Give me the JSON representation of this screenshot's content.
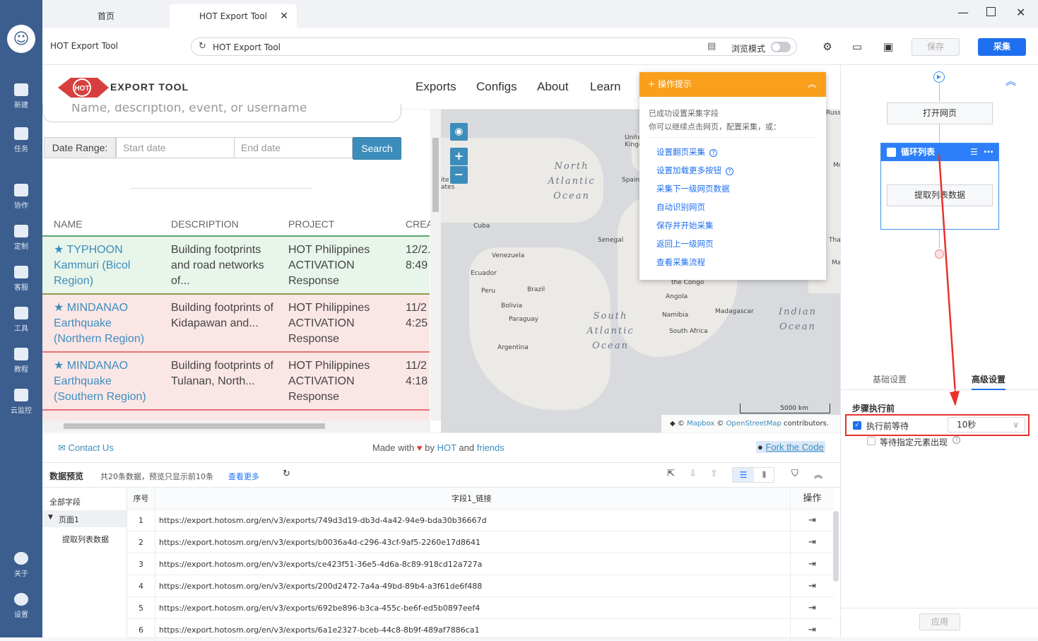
{
  "nav": {
    "items": [
      {
        "label": "新建",
        "icon": "new-icon"
      },
      {
        "label": "任务",
        "icon": "task-icon"
      },
      {
        "label": "协作",
        "icon": "collab-icon"
      },
      {
        "label": "定制",
        "icon": "custom-icon"
      },
      {
        "label": "客服",
        "icon": "headset-icon"
      },
      {
        "label": "工具",
        "icon": "toolbox-icon"
      },
      {
        "label": "教程",
        "icon": "tutorial-icon"
      },
      {
        "label": "云监控",
        "icon": "cloud-icon"
      },
      {
        "label": "关于",
        "icon": "info-icon"
      },
      {
        "label": "设置",
        "icon": "gear-icon"
      }
    ]
  },
  "tabs": {
    "home": "首页",
    "active": "HOT Export Tool"
  },
  "toolbar": {
    "page_title": "HOT Export Tool",
    "url": "HOT Export Tool",
    "browse_mode": "浏览模式",
    "save": "保存",
    "collect": "采集"
  },
  "web": {
    "brand": "EXPORT TOOL",
    "logo_text": "HOT",
    "nav": [
      "Exports",
      "Configs",
      "About",
      "Learn"
    ],
    "search_placeholder": "Name, description, event, or username",
    "date_range_label": "Date Range:",
    "start_placeholder": "Start date",
    "end_placeholder": "End date",
    "search_button": "Search",
    "table": {
      "headers": [
        "NAME",
        "DESCRIPTION",
        "PROJECT",
        "CREA"
      ],
      "rows": [
        {
          "name": "★ TYPHOON Kammuri (Bicol Region)",
          "desc": "Building footprints and road networks of...",
          "project": "HOT Philippines ACTIVATION Response",
          "date": "12/2. 8:49"
        },
        {
          "name": "★ MINDANAO Earthquake (Northern Region)",
          "desc": "Building footprints of Kidapawan and...",
          "project": "HOT Philippines ACTIVATION Response",
          "date": "11/2 4:25"
        },
        {
          "name": "★ MINDANAO Earthquake (Southern Region)",
          "desc": "Building footprints of Tulanan, North...",
          "project": "HOT Philippines ACTIVATION Response",
          "date": "11/2 4:18"
        }
      ]
    },
    "map": {
      "labels": [
        "Cuba",
        "Venezuela",
        "Ecuador",
        "Peru",
        "Brazil",
        "Bolivia",
        "Paraguay",
        "Argentina",
        "Senegal",
        "Spain",
        "the Congo",
        "Angola",
        "Namibia",
        "South Africa",
        "Madagascar",
        "United Kingd",
        "ite ates",
        "Russ",
        "Tha",
        "Ma",
        "Mc"
      ],
      "oceans": [
        "North Atlantic Ocean",
        "South Atlantic Ocean",
        "Indian Ocean"
      ],
      "scale": "5000 km",
      "attribution": {
        "mapbox": "Mapbox",
        "osm": "OpenStreetMap",
        "suffix": "contributors."
      }
    },
    "footer": {
      "contact": "Contact Us",
      "made_with": "Made with",
      "by": "by",
      "hot": "HOT",
      "and": "and",
      "friends": "friends",
      "fork": "Fork the Code"
    }
  },
  "tips": {
    "title": "操作提示",
    "line1": "已成功设置采集字段",
    "line2": "你可以继续点击网页，配置采集，或：",
    "links": [
      "设置翻页采集",
      "设置加载更多按钮",
      "采集下一级网页数据",
      "自动识别网页",
      "保存并开始采集",
      "返回上一级网页",
      "查看采集流程"
    ]
  },
  "preview": {
    "title": "数据预览",
    "summary": "共20条数据，预览只显示前10条",
    "more": "查看更多",
    "tree": {
      "all": "全部字段",
      "page": "页面1",
      "extract": "提取列表数据"
    },
    "columns": {
      "index": "序号",
      "field": "字段1_链接",
      "ops": "操作"
    },
    "rows": [
      {
        "i": "1",
        "url": "https://export.hotosm.org/en/v3/exports/749d3d19-db3d-4a42-94e9-bda30b36667d"
      },
      {
        "i": "2",
        "url": "https://export.hotosm.org/en/v3/exports/b0036a4d-c296-43cf-9af5-2260e17d8641"
      },
      {
        "i": "3",
        "url": "https://export.hotosm.org/en/v3/exports/ce423f51-36e5-4d6a-8c89-918cd12a727a"
      },
      {
        "i": "4",
        "url": "https://export.hotosm.org/en/v3/exports/200d2472-7a4a-49bd-89b4-a3f61de6f488"
      },
      {
        "i": "5",
        "url": "https://export.hotosm.org/en/v3/exports/692be896-b3ca-455c-be6f-ed5b0897eef4"
      },
      {
        "i": "6",
        "url": "https://export.hotosm.org/en/v3/exports/6a1e2327-bceb-44c8-8b9f-489af7886ca1"
      }
    ]
  },
  "workflow": {
    "open_page": "打开网页",
    "loop_list": "循环列表",
    "extract": "提取列表数据",
    "tab_basic": "基础设置",
    "tab_advanced": "高级设置",
    "section": "步骤执行前",
    "wait_before": "执行前等待",
    "wait_value": "10秒",
    "wait_element": "等待指定元素出现",
    "apply": "应用"
  },
  "colors": {
    "nav_bg": "#3c5e8f",
    "accent": "#1e6fef",
    "tips": "#f99f1b",
    "highlight": "#e8322a"
  }
}
